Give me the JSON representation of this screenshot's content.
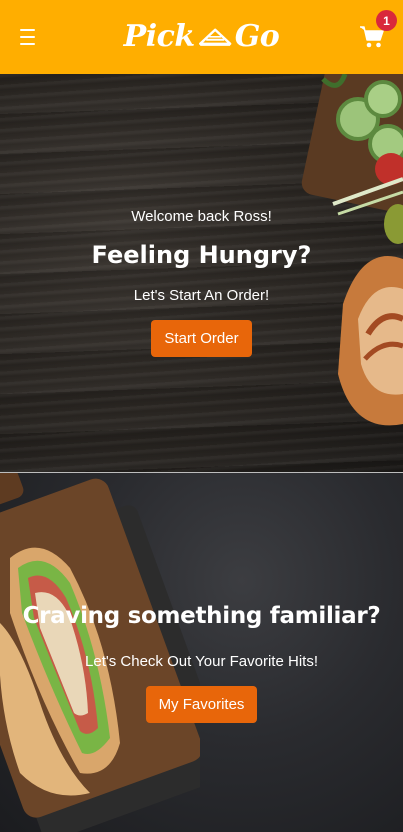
{
  "header": {
    "menu_icon": "hamburger-menu-icon",
    "logo_text_left": "Pick",
    "logo_text_right": "Go",
    "cart_icon": "shopping-cart-icon",
    "cart_count": "1",
    "background_color": "#ffae00",
    "badge_color": "#d9283b"
  },
  "hero_order": {
    "welcome": "Welcome back Ross!",
    "headline": "Feeling Hungry?",
    "subline": "Let's Start An Order!",
    "button_label": "Start Order"
  },
  "hero_favorites": {
    "headline": "Craving something familiar?",
    "subline": "Let's Check Out Your Favorite Hits!",
    "button_label": "My Favorites"
  },
  "colors": {
    "accent": "#e8660a"
  }
}
